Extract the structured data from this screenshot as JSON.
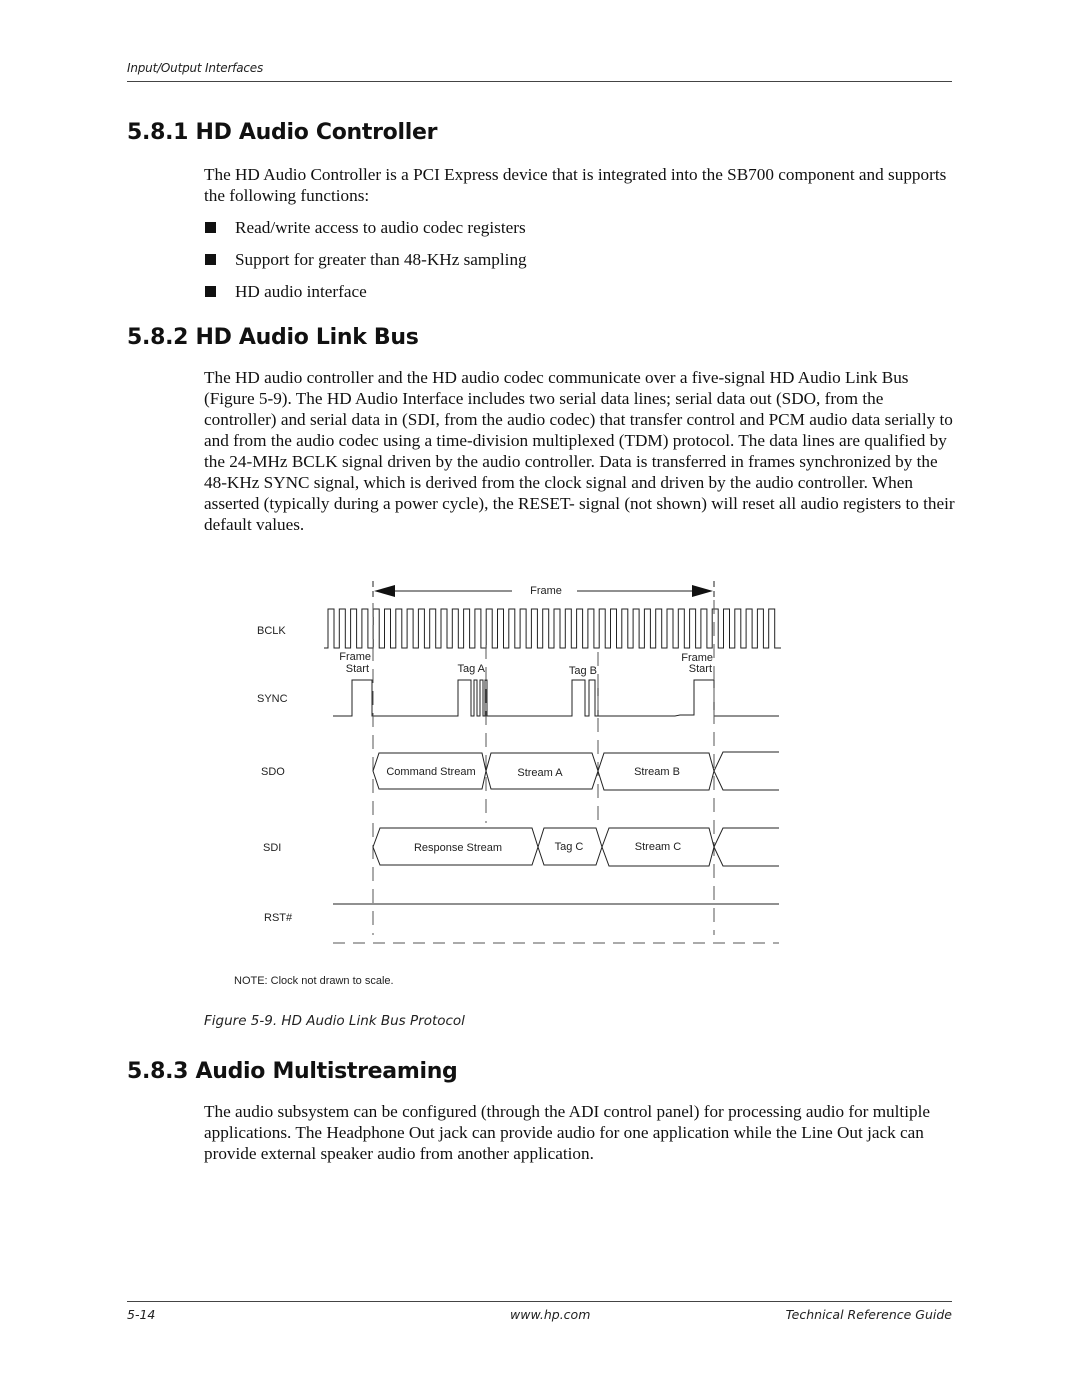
{
  "header": {
    "running_title": "Input/Output Interfaces"
  },
  "sections": [
    {
      "title": "5.8.1 HD Audio Controller",
      "paragraph": "The HD Audio Controller is a PCI Express device that is integrated into the SB700 component and supports the following functions:",
      "bullets": [
        "Read/write access to audio codec registers",
        "Support for greater than 48-KHz sampling",
        "HD audio interface"
      ]
    },
    {
      "title": "5.8.2 HD Audio Link Bus",
      "paragraph": "The HD audio controller and the HD audio codec communicate over a five-signal HD Audio Link Bus (Figure 5-9). The HD Audio Interface includes two serial data lines; serial data out (SDO, from the controller) and serial data in (SDI, from the audio codec) that transfer control and PCM audio data serially to and from the audio codec using a time-division multiplexed (TDM) protocol. The data lines are qualified by the 24-MHz BCLK signal driven by the audio controller. Data is transferred in frames synchronized by the 48-KHz SYNC signal, which is derived from the clock signal and driven by the audio controller. When asserted (typically during a power cycle), the RESET- signal (not shown) will reset all audio registers to their default values."
    },
    {
      "title": "5.8.3 Audio Multistreaming",
      "paragraph": "The audio subsystem can be configured (through the ADI control panel) for processing audio for multiple applications. The Headphone Out jack can provide audio for one application while the Line Out jack can provide external speaker audio from another application."
    }
  ],
  "figure": {
    "caption": "Figure 5-9. HD Audio Link Bus Protocol",
    "note": "NOTE: Clock not drawn to scale.",
    "frame_label": "Frame",
    "signals": {
      "bclk": "BCLK",
      "sync": "SYNC",
      "sdo": "SDO",
      "sdi": "SDI",
      "rst": "RST#"
    },
    "sync_labels": {
      "frame_start_1_line1": "Frame",
      "frame_start_1_line2": "Start",
      "tag_a": "Tag A",
      "tag_b": "Tag B",
      "frame_start_2_line1": "Frame",
      "frame_start_2_line2": "Start"
    },
    "sdo_segments": [
      "Command Stream",
      "Stream A",
      "Stream B",
      ""
    ],
    "sdi_segments": [
      "Response Stream",
      "Tag C",
      "Stream C",
      ""
    ]
  },
  "footer": {
    "page_number": "5-14",
    "url": "www.hp.com",
    "guide_title": "Technical Reference Guide"
  }
}
